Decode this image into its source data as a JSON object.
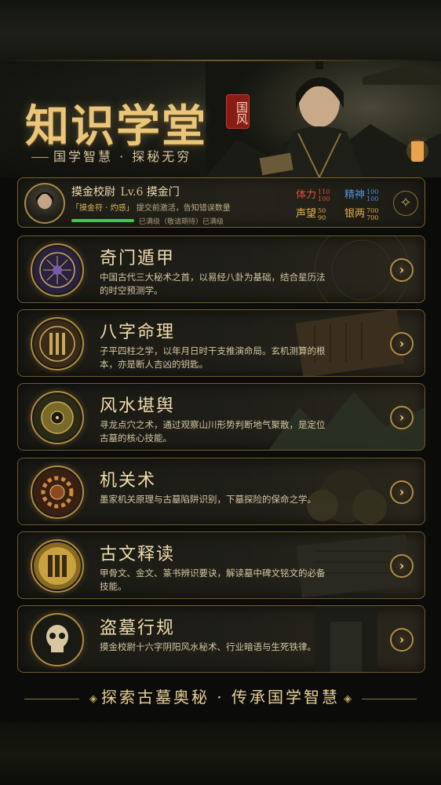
{
  "hero": {
    "title": "知识学堂",
    "seal": "国风",
    "subtitle": "国学智慧 · 探秘无穷"
  },
  "profile": {
    "name": "摸金校尉",
    "level": "Lv.6",
    "sect": "摸金门",
    "note_prefix": "「摸金符 · 灼感」",
    "note_suffix": "提交前激活，告知错误数量",
    "progress": 1.0,
    "progress_text": "已满级（敬请期待）已满级",
    "stats": [
      {
        "label": "体力",
        "cur": "110",
        "max": "100",
        "color": "#e0503c"
      },
      {
        "label": "精神",
        "cur": "100",
        "max": "100",
        "color": "#4f8fe0"
      },
      {
        "label": "声望",
        "cur": "50",
        "max": "90",
        "color": "#e0b050"
      },
      {
        "label": "银两",
        "cur": "700",
        "max": "700",
        "color": "#e0b050"
      }
    ],
    "emblem_icon": "compass-icon"
  },
  "cards": [
    {
      "title": "奇门遁甲",
      "desc": "中国古代三大秘术之首，以易经八卦为基础，结合星历法的时空预测学。",
      "icon": "bagua-icon"
    },
    {
      "title": "八字命理",
      "desc": "子平四柱之学，以年月日时干支推演命局。玄机测算的根本，亦是断人吉凶的钥匙。",
      "icon": "scroll-icon"
    },
    {
      "title": "风水堪舆",
      "desc": "寻龙点穴之术，通过观察山川形势判断地气聚散，是定位古墓的核心技能。",
      "icon": "luopan-icon"
    },
    {
      "title": "机关术",
      "desc": "墨家机关原理与古墓陷阱识别，下墓探险的保命之学。",
      "icon": "gear-icon"
    },
    {
      "title": "古文释读",
      "desc": "甲骨文、金文、篆书辨识要诀，解读墓中碑文铭文的必备技能。",
      "icon": "bamboo-slips-icon"
    },
    {
      "title": "盗墓行规",
      "desc": "摸金校尉十六字阴阳风水秘术、行业暗语与生死铁律。",
      "icon": "skull-icon"
    }
  ],
  "arrow_glyph": "›",
  "footer": {
    "text": "探索古墓奥秘 · 传承国学智慧"
  },
  "colors": {
    "gold": "#e9c67a",
    "border": "#6f5a2c",
    "bg": "#0b0c0a"
  }
}
